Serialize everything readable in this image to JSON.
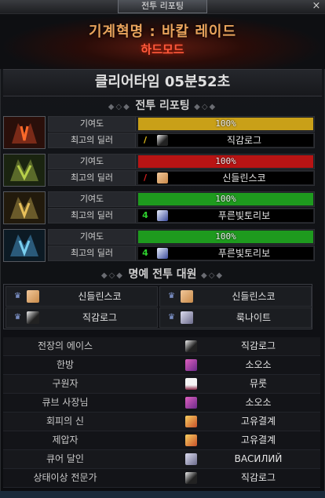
{
  "window": {
    "title": "전투 리포팅",
    "close_label": "×"
  },
  "header": {
    "raid_name": "기계혁명 : 바칼 레이드",
    "mode": "하드모드"
  },
  "clear_time": "클리어타임  05분52초",
  "sections": {
    "report_title": "전투 리포팅",
    "honor_title": "명예 전투 대원"
  },
  "labels": {
    "contribution": "기여도",
    "top_dealer": "최고의 딜러"
  },
  "parties": [
    {
      "portrait": "red-dragon-portrait",
      "contribution_text": "100%",
      "contribution": 1.0,
      "bar_color": "#c9a018",
      "class_icon": "slash-icon",
      "class_color": "#e8c21a",
      "dealer": "직감로그"
    },
    {
      "portrait": "green-dragon-portrait",
      "contribution_text": "100%",
      "contribution": 1.0,
      "bar_color": "#b81414",
      "class_icon": "slash-icon",
      "class_color": "#e02020",
      "dealer": "신들린스코"
    },
    {
      "portrait": "gold-dragon-portrait",
      "contribution_text": "100%",
      "contribution": 1.0,
      "bar_color": "#1e9a1e",
      "class_icon": "four-icon",
      "class_color": "#2ed02e",
      "dealer": "푸른빛토리보"
    },
    {
      "portrait": "blue-dragon-portrait",
      "contribution_text": "100%",
      "contribution": 1.0,
      "bar_color": "#1e9a1e",
      "class_icon": "four-icon",
      "class_color": "#2ed02e",
      "dealer": "푸른빛토리보"
    }
  ],
  "honor": [
    {
      "name": "신들린스코"
    },
    {
      "name": "신들린스코"
    },
    {
      "name": "직감로그"
    },
    {
      "name": "룩나이트"
    }
  ],
  "awards": [
    {
      "title": "전장의 에이스",
      "player": "직감로그"
    },
    {
      "title": "한방",
      "player": "소오소"
    },
    {
      "title": "구원자",
      "player": "뮤룻"
    },
    {
      "title": "큐브 사장님",
      "player": "소오소"
    },
    {
      "title": "회피의 신",
      "player": "고유결계"
    },
    {
      "title": "제압자",
      "player": "고유결계"
    },
    {
      "title": "큐어 달인",
      "player": "ВАСИЛИЙ"
    },
    {
      "title": "상태이상 전문가",
      "player": "직감로그"
    }
  ],
  "colors": {
    "accent": "#e8a35c",
    "hardmode": "#ff5a3c"
  }
}
